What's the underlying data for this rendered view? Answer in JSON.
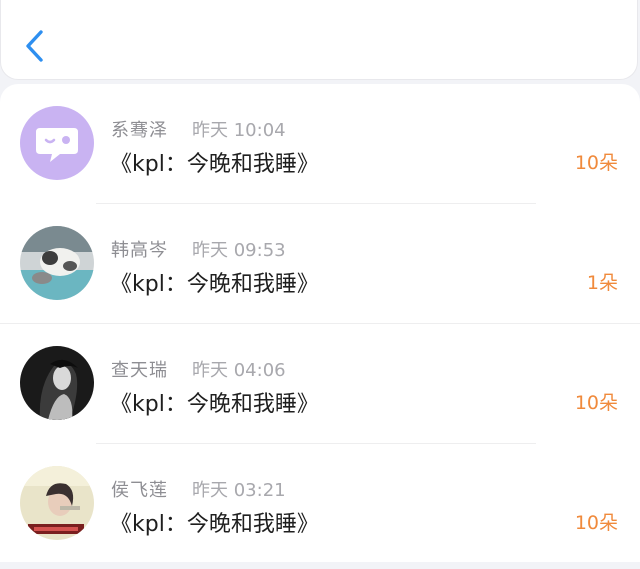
{
  "header": {
    "back_icon": "chevron-left-icon",
    "accent_color": "#2e8ff0"
  },
  "items": [
    {
      "name": "系骞泽",
      "time": "昨天 10:04",
      "message": "《kpl：今晚和我睡》",
      "count": "10朵",
      "avatar": "purple-chat-bubble-avatar"
    },
    {
      "name": "韩高岑",
      "time": "昨天 09:53",
      "message": "《kpl：今晚和我睡》",
      "count": "1朵",
      "avatar": "cat-photo-avatar"
    },
    {
      "name": "查天瑞",
      "time": "昨天 04:06",
      "message": "《kpl：今晚和我睡》",
      "count": "10朵",
      "avatar": "dark-portrait-avatar"
    },
    {
      "name": "侯飞莲",
      "time": "昨天 03:21",
      "message": "《kpl：今晚和我睡》",
      "count": "10朵",
      "avatar": "light-portrait-avatar"
    }
  ],
  "colors": {
    "count": "#f08a3c",
    "name": "#8e8e93",
    "message": "#1f1f1f"
  }
}
